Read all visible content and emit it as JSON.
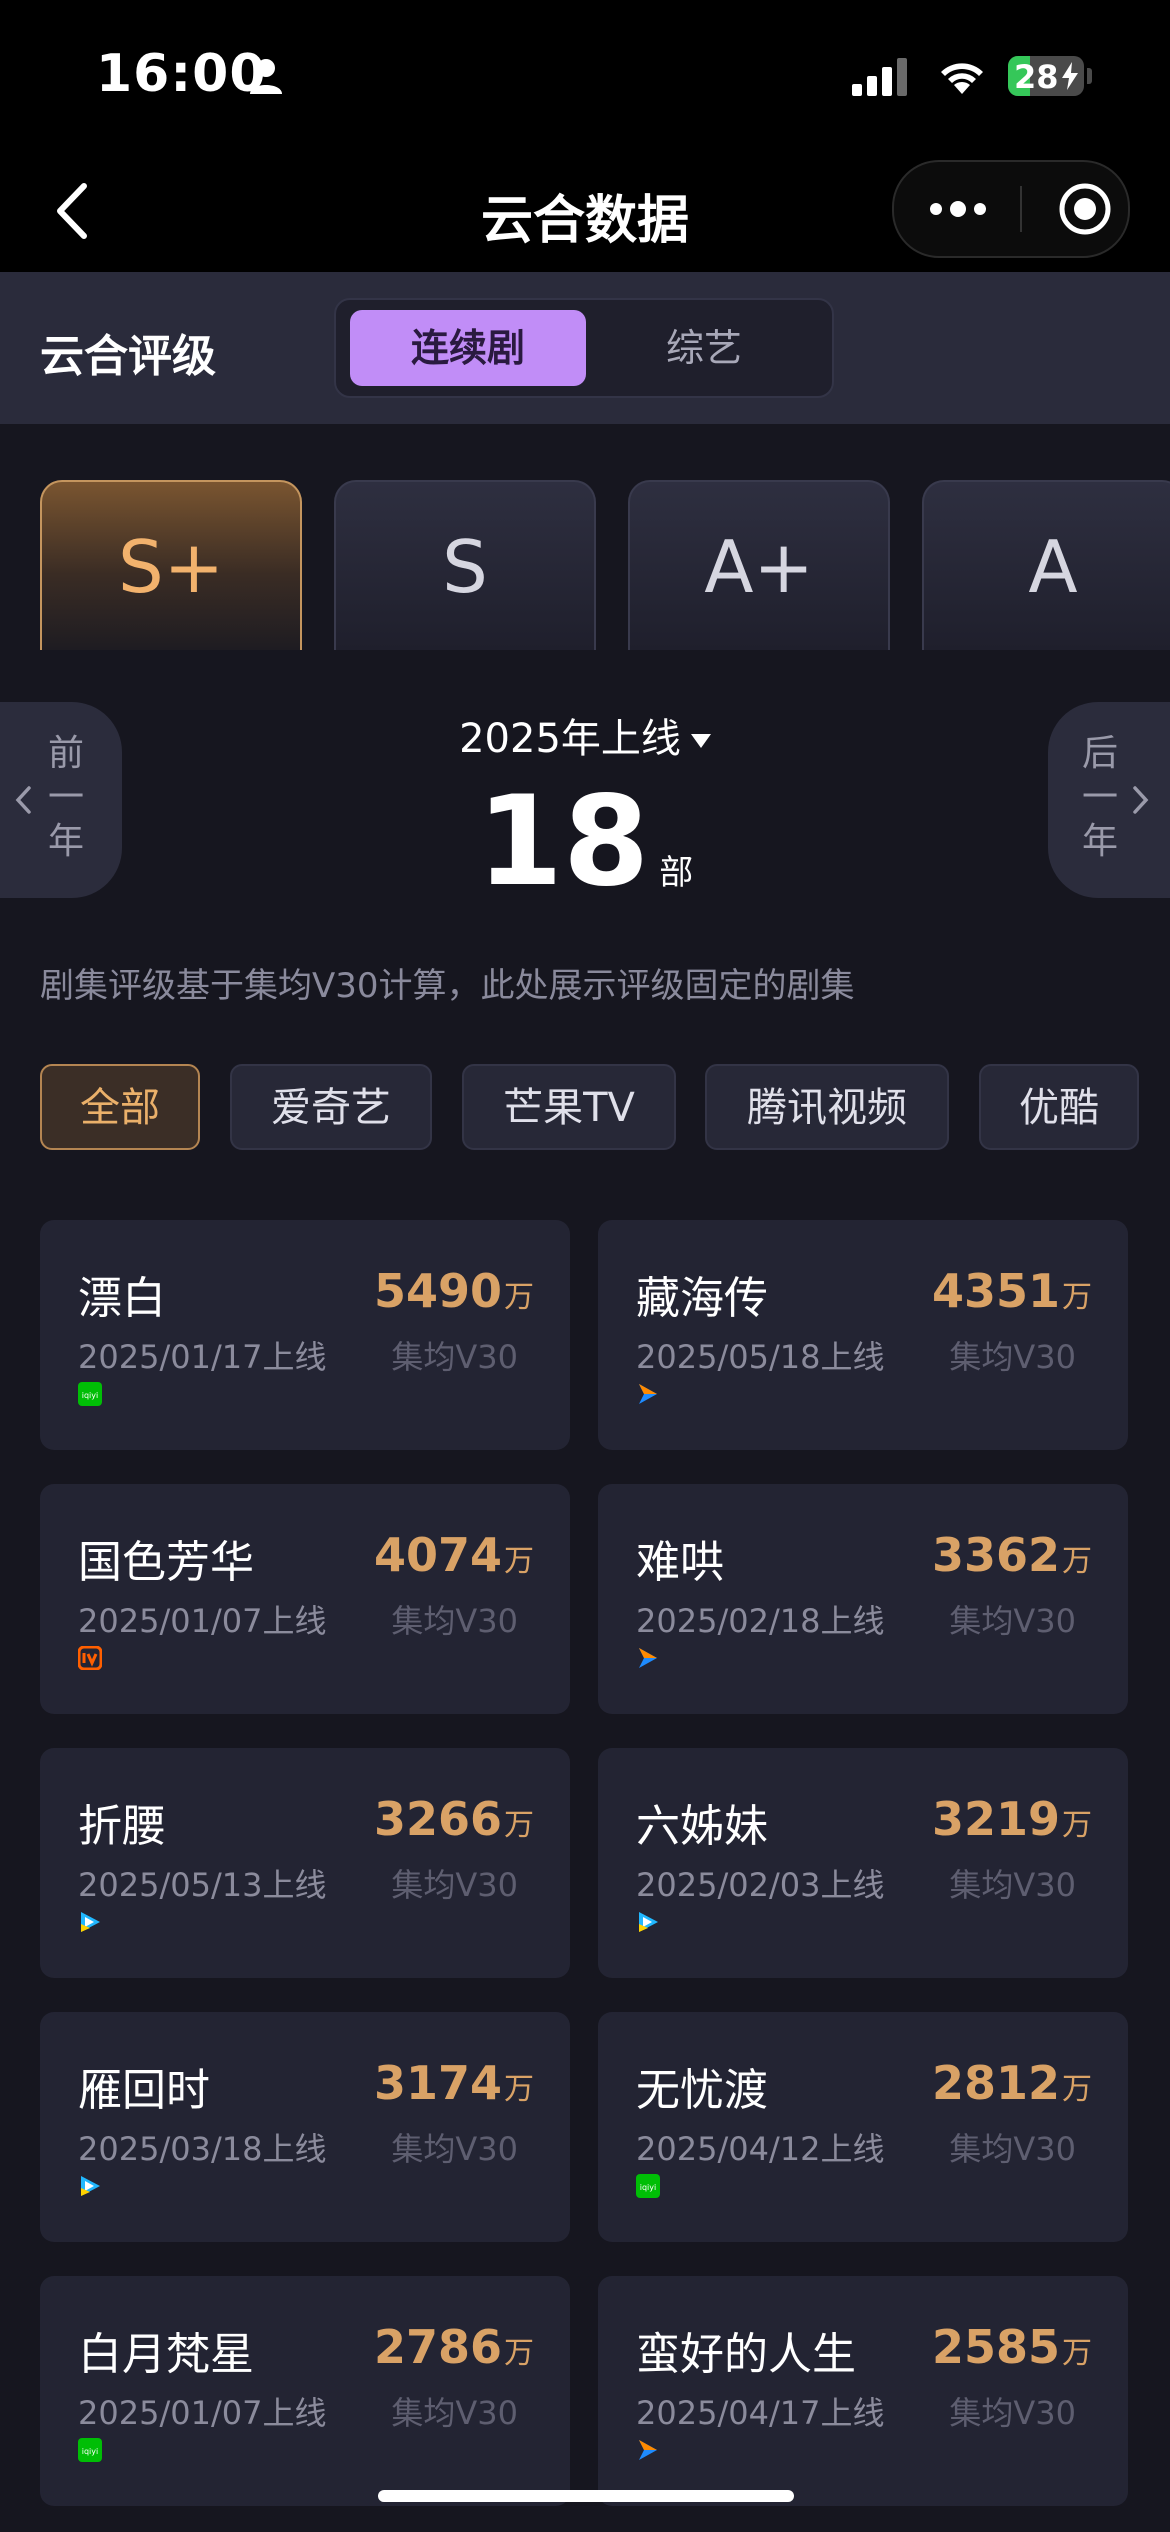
{
  "status_bar": {
    "time": "16:00",
    "battery": "28"
  },
  "nav": {
    "title": "云合数据"
  },
  "sub_header": {
    "title": "云合评级",
    "segments": [
      {
        "label": "连续剧",
        "active": true
      },
      {
        "label": "综艺",
        "active": false
      }
    ]
  },
  "grades": [
    {
      "label": "S+",
      "active": true
    },
    {
      "label": "S",
      "active": false
    },
    {
      "label": "A+",
      "active": false
    },
    {
      "label": "A",
      "active": false
    }
  ],
  "year_nav": {
    "prev": [
      "前",
      "一",
      "年"
    ],
    "next": [
      "后",
      "一",
      "年"
    ],
    "selected": "2025年上线",
    "count": "18",
    "count_unit": "部"
  },
  "note": "剧集评级基于集均V30计算，此处展示评级固定的剧集",
  "filters": [
    {
      "label": "全部",
      "active": true
    },
    {
      "label": "爱奇艺",
      "active": false
    },
    {
      "label": "芒果TV",
      "active": false
    },
    {
      "label": "腾讯视频",
      "active": false
    },
    {
      "label": "优酷",
      "active": false
    }
  ],
  "dramas": [
    {
      "name": "漂白",
      "date": "2025/01/17上线",
      "value": "5490",
      "unit": "万",
      "metric": "集均V30",
      "platform": "iqiyi-icon"
    },
    {
      "name": "藏海传",
      "date": "2025/05/18上线",
      "value": "4351",
      "unit": "万",
      "metric": "集均V30",
      "platform": "youku-icon"
    },
    {
      "name": "国色芳华",
      "date": "2025/01/07上线",
      "value": "4074",
      "unit": "万",
      "metric": "集均V30",
      "platform": "mangotv-icon"
    },
    {
      "name": "难哄",
      "date": "2025/02/18上线",
      "value": "3362",
      "unit": "万",
      "metric": "集均V30",
      "platform": "youku-icon"
    },
    {
      "name": "折腰",
      "date": "2025/05/13上线",
      "value": "3266",
      "unit": "万",
      "metric": "集均V30",
      "platform": "tencent-video-icon"
    },
    {
      "name": "六姊妹",
      "date": "2025/02/03上线",
      "value": "3219",
      "unit": "万",
      "metric": "集均V30",
      "platform": "tencent-video-icon"
    },
    {
      "name": "雁回时",
      "date": "2025/03/18上线",
      "value": "3174",
      "unit": "万",
      "metric": "集均V30",
      "platform": "tencent-video-icon"
    },
    {
      "name": "无忧渡",
      "date": "2025/04/12上线",
      "value": "2812",
      "unit": "万",
      "metric": "集均V30",
      "platform": "iqiyi-icon"
    },
    {
      "name": "白月梵星",
      "date": "2025/01/07上线",
      "value": "2786",
      "unit": "万",
      "metric": "集均V30",
      "platform": "iqiyi-icon"
    },
    {
      "name": "蛮好的人生",
      "date": "2025/04/17上线",
      "value": "2585",
      "unit": "万",
      "metric": "集均V30",
      "platform": "youku-icon"
    }
  ],
  "colors": {
    "accent_purple": "#c18df7",
    "gold": "#d9a266",
    "background": "#16161f",
    "card": "#232433",
    "iqiyi": "#00be06",
    "youku": "#1e8bff",
    "mangotv": "#ff5f00",
    "tencent": "#21b8ff"
  }
}
